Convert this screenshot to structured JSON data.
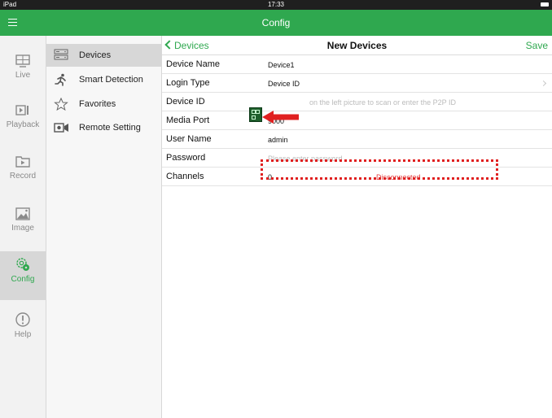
{
  "status_bar": {
    "carrier": "iPad",
    "time": "17:33"
  },
  "app_bar": {
    "title": "Config"
  },
  "left_nav": [
    {
      "id": "live",
      "label": "Live"
    },
    {
      "id": "playback",
      "label": "Playback"
    },
    {
      "id": "record",
      "label": "Record"
    },
    {
      "id": "image",
      "label": "Image"
    },
    {
      "id": "config",
      "label": "Config",
      "active": true
    },
    {
      "id": "help",
      "label": "Help"
    }
  ],
  "submenu": [
    {
      "label": "Devices",
      "icon": "devices-icon",
      "active": true
    },
    {
      "label": "Smart Detection",
      "icon": "person-running-icon"
    },
    {
      "label": "Favorites",
      "icon": "star-icon"
    },
    {
      "label": "Remote Setting",
      "icon": "camera-settings-icon"
    }
  ],
  "page": {
    "back_label": "Devices",
    "title": "New Devices",
    "save_label": "Save"
  },
  "form": {
    "device_name": {
      "label": "Device Name",
      "value": "Device1"
    },
    "login_type": {
      "label": "Login Type",
      "value": "Device ID"
    },
    "device_id": {
      "label": "Device ID",
      "placeholder": "on the left picture to scan or enter the P2P ID"
    },
    "media_port": {
      "label": "Media Port",
      "value": "9000"
    },
    "user_name": {
      "label": "User Name",
      "value": "admin"
    },
    "password": {
      "label": "Password",
      "placeholder": "Please enter password"
    },
    "channels": {
      "label": "Channels",
      "value": "0",
      "status": "Disconnected"
    }
  },
  "colors": {
    "accent": "#2fa84f",
    "error": "#e23b3b",
    "highlight": "#e02020"
  }
}
